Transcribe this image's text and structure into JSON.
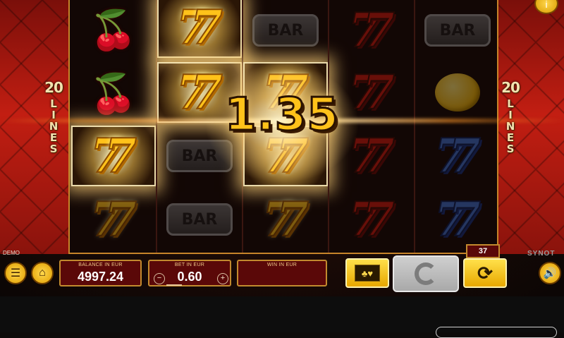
{
  "game": {
    "lines_number": "20",
    "lines_word": "LINES",
    "win_amount": "1.35",
    "demo_label": "DEMO",
    "provider": "SYNOT",
    "autoplay_count": "37"
  },
  "reels": [
    [
      "cherry",
      "cherry",
      "seven",
      "seven"
    ],
    [
      "seven",
      "seven",
      "bar",
      "bar"
    ],
    [
      "bar",
      "seven",
      "seven",
      "seven"
    ],
    [
      "seven",
      "seven",
      "seven",
      "seven"
    ],
    [
      "bar",
      "lemon",
      "seven",
      "seven"
    ]
  ],
  "symbol_text": {
    "bar": "BAR",
    "seven": "7",
    "cherry": "🍒"
  },
  "panels": {
    "balance_label": "BALANCE IN EUR",
    "balance_value": "4997.24",
    "bet_label": "BET IN EUR",
    "bet_value": "0.60",
    "bet_minus": "−",
    "bet_plus": "+",
    "win_label": "WIN IN EUR",
    "win_value": ""
  },
  "icons": {
    "menu": "☰",
    "home": "⌂",
    "gamble": "♣♥",
    "autoplay": "⟳",
    "sound": "🔊",
    "info": "i"
  }
}
